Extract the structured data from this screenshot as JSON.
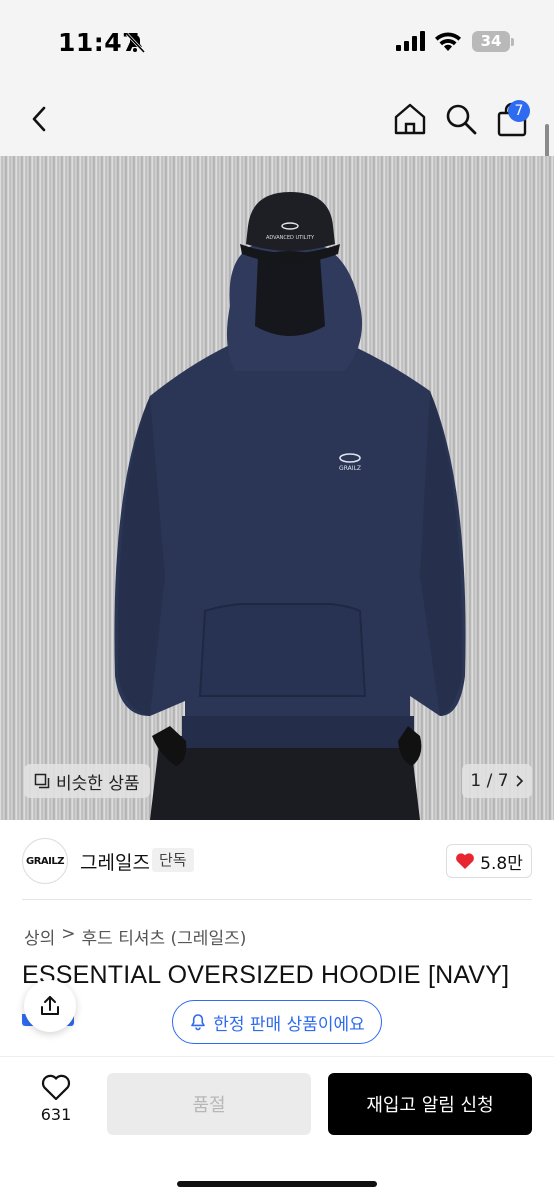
{
  "status_bar": {
    "time": "11:47",
    "battery": "34",
    "icons": [
      "bell-muted-icon",
      "signal-icon",
      "wifi-icon",
      "battery-icon"
    ]
  },
  "nav": {
    "icons": [
      "back-icon",
      "home-icon",
      "search-icon",
      "shopping-bag-icon"
    ],
    "cart_count": "7"
  },
  "gallery": {
    "similar_label": "비슷한 상품",
    "counter": "1 / 7",
    "image_logo_text": "GRAILZ",
    "cap_text": "ADVANCED UTILITY"
  },
  "brand": {
    "logo_text": "GRAILZ",
    "name": "그레일즈",
    "tag": "단독",
    "likes": "5.8만"
  },
  "product": {
    "breadcrumb": [
      "상의",
      "후드 티셔츠 (그레일즈)"
    ],
    "title": "ESSENTIAL OVERSIZED HOODIE [NAVY]"
  },
  "notice": {
    "limited_label": "한정 판매 상품이에요"
  },
  "actions": {
    "wish_count": "631",
    "soldout_label": "품절",
    "restock_label": "재입고 알림 신청"
  },
  "colors": {
    "accent": "#2f6bf0",
    "heart": "#e8262f",
    "primary_button": "#000000"
  }
}
